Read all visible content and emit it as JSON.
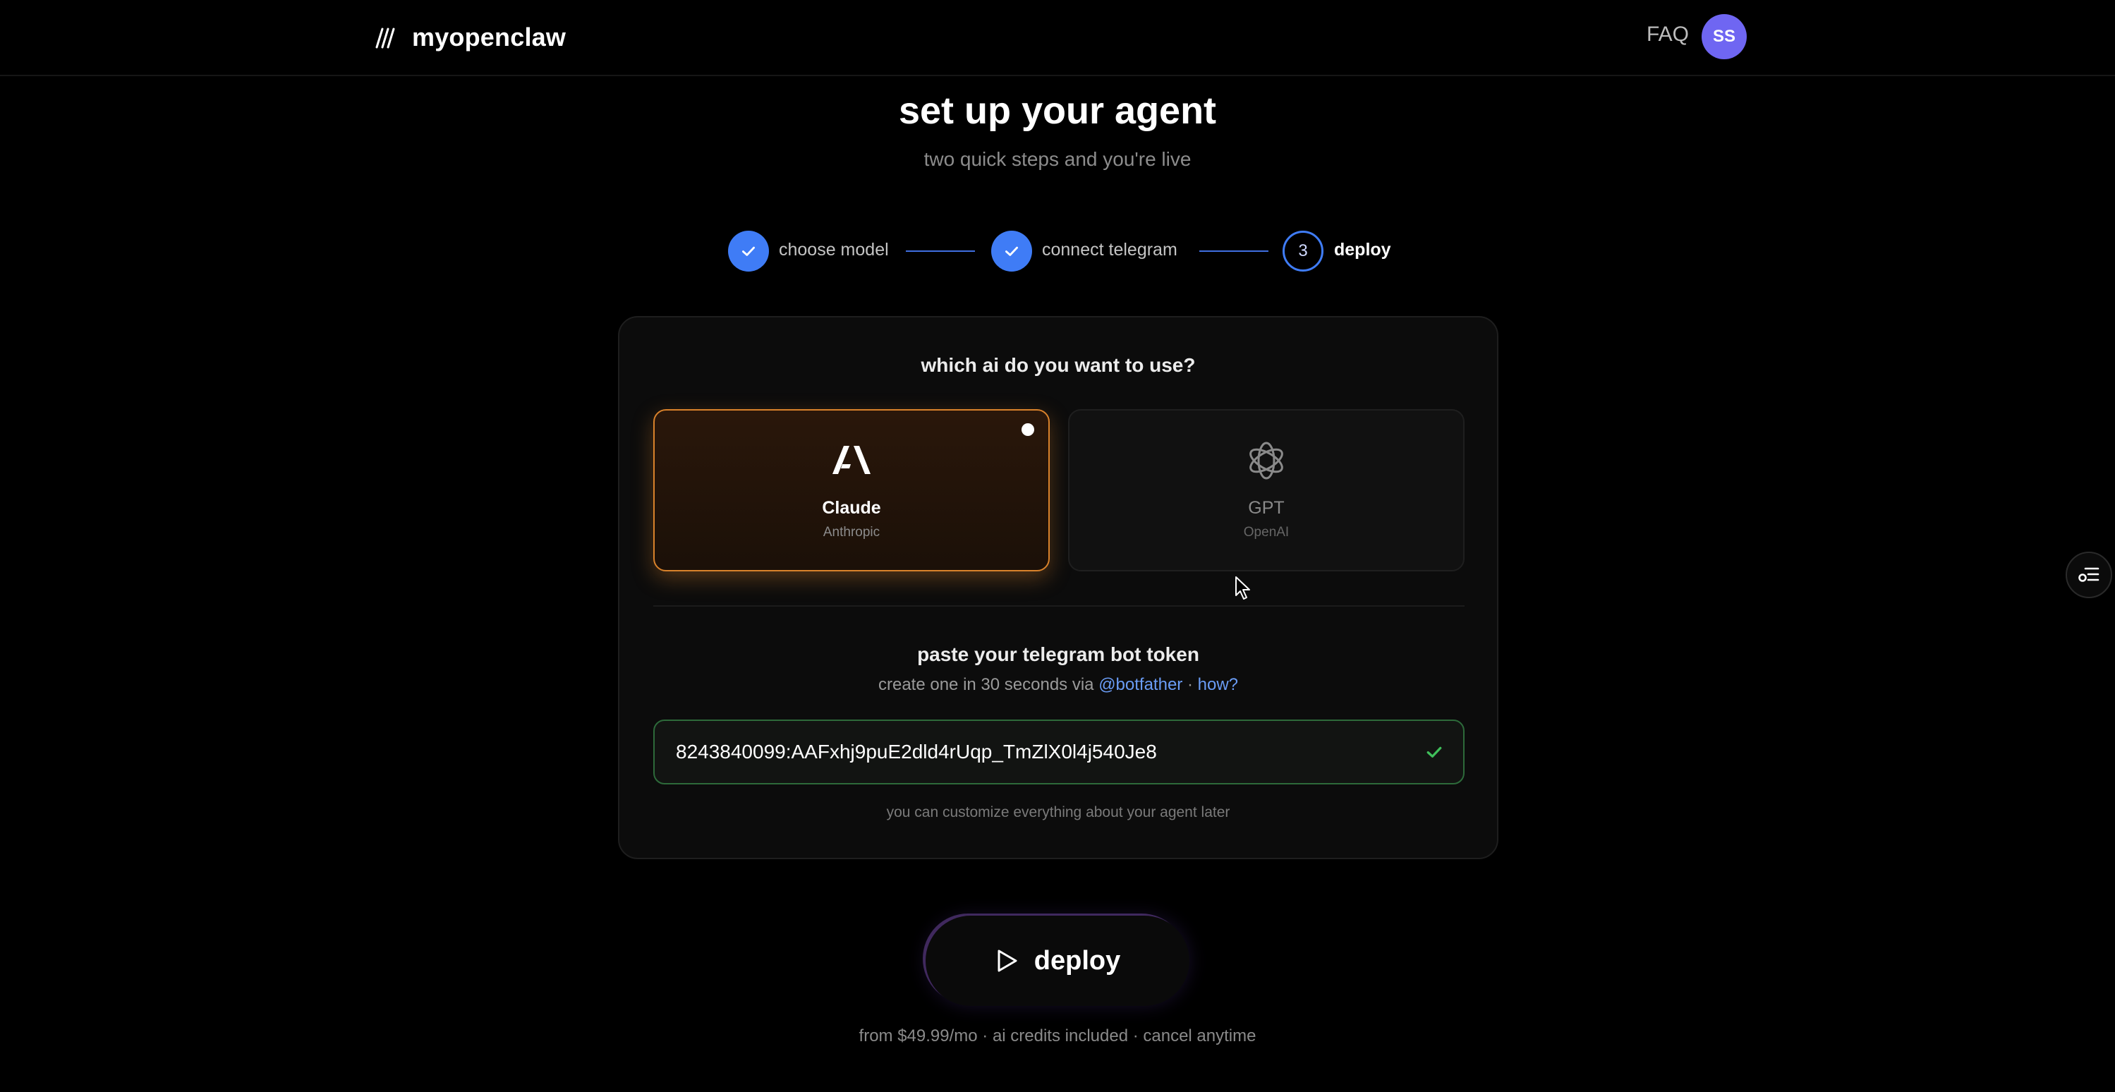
{
  "header": {
    "brand": "myopenclaw",
    "faq": "FAQ",
    "avatar_initials": "SS"
  },
  "hero": {
    "title": "set up your agent",
    "subtitle": "two quick steps and you're live"
  },
  "steps": [
    {
      "label": "choose model",
      "status": "done"
    },
    {
      "label": "connect telegram",
      "status": "done"
    },
    {
      "label": "deploy",
      "number": "3",
      "status": "current"
    }
  ],
  "model_section": {
    "question": "which ai do you want to use?",
    "options": [
      {
        "name": "Claude",
        "vendor": "Anthropic",
        "icon": "anthropic-logo-icon",
        "selected": true
      },
      {
        "name": "GPT",
        "vendor": "OpenAI",
        "icon": "openai-logo-icon",
        "selected": false
      }
    ]
  },
  "token_section": {
    "title": "paste your telegram bot token",
    "help_prefix": "create one in 30 seconds via",
    "botfather_link": "@botfather",
    "separator": "·",
    "how_link": "how?",
    "value": "8243840099:AAFxhj9puE2dld4rUqp_TmZlX0l4j540Je8",
    "status": "valid",
    "note": "you can customize everything about your agent later"
  },
  "deploy": {
    "label": "deploy",
    "pricing": "from $49.99/mo · ai credits included · cancel anytime"
  },
  "colors": {
    "accent_blue": "#3f7cf6",
    "selected_orange": "#d9822b",
    "valid_green": "#3fbf5a",
    "avatar": "#6f66f2"
  }
}
